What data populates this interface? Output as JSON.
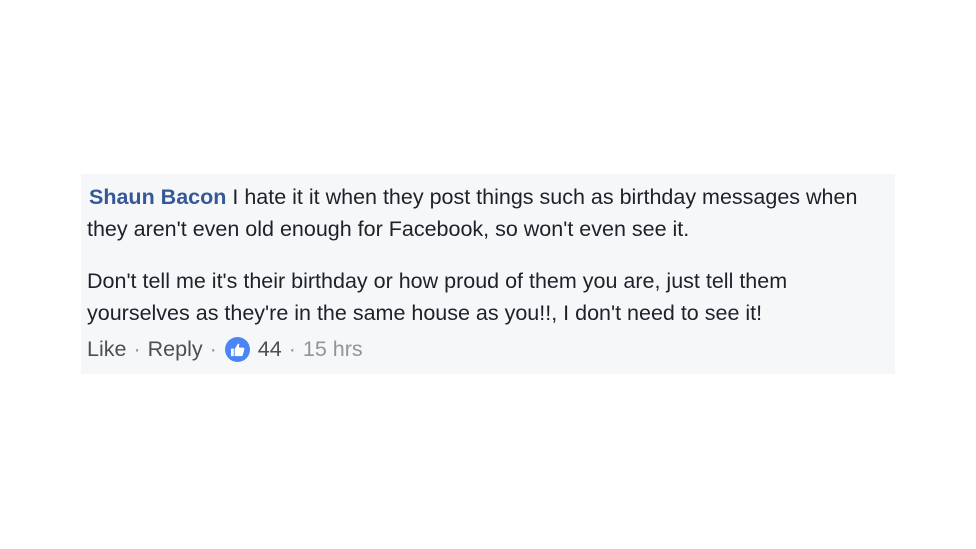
{
  "comment": {
    "author": "Shaun Bacon",
    "paragraphs": [
      "I hate it it when they post things such as birthday messages when they aren't even old enough for Facebook, so won't even see it.",
      "Don't tell me it's their birthday or how proud of them you are, just tell them yourselves as they're in the same house as you!!, I don't need to see it!"
    ],
    "actions": {
      "like_label": "Like",
      "reply_label": "Reply",
      "separator": "·",
      "like_count": "44",
      "timestamp": "15 hrs"
    }
  },
  "colors": {
    "author": "#365899",
    "box_background": "#f6f7f9",
    "like_badge": "#4b85f5",
    "meta_text": "#90949c"
  },
  "icons": {
    "reaction": "thumbs-up-icon"
  }
}
